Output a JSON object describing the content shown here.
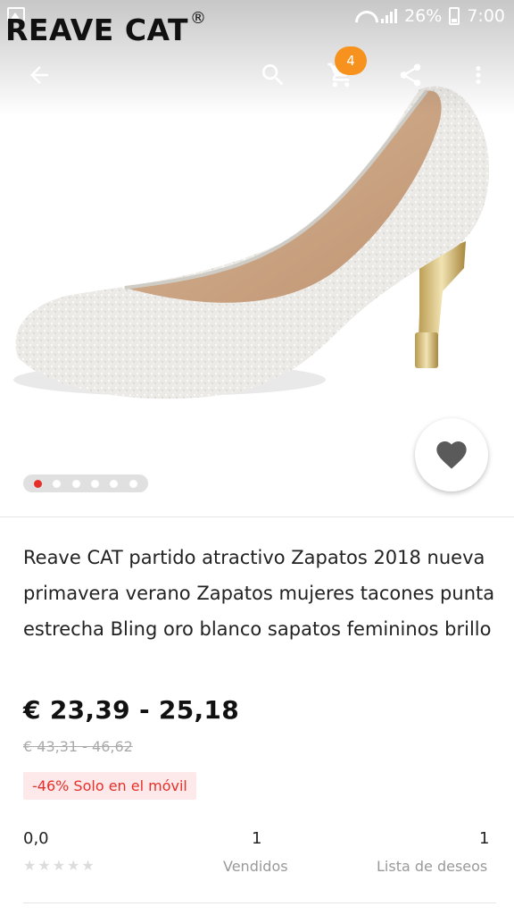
{
  "status_bar": {
    "battery": "26%",
    "time": "7:00"
  },
  "watermark": {
    "text": "REAVE CAT",
    "mark": "®"
  },
  "toolbar": {
    "back_icon": "arrow-back-icon",
    "search_icon": "search-icon",
    "cart_icon": "cart-icon",
    "cart_badge": "4",
    "share_icon": "share-icon",
    "more_icon": "more-vert-icon"
  },
  "gallery": {
    "image_count": 6,
    "active_index": 0
  },
  "favorite": {
    "icon": "heart-icon"
  },
  "product": {
    "title": "Reave CAT partido atractivo Zapatos 2018 nueva primavera verano Zapatos mujeres tacones punta estrecha Bling oro blanco sapatos femininos brillo",
    "price": "€ 23,39 - 25,18",
    "original_price": "€ 43,31 - 46,62",
    "discount": "-46% Solo en el móvil"
  },
  "stats": {
    "rating_value": "0,0",
    "stars_filled": 0,
    "stars_total": 5,
    "sold_value": "1",
    "sold_label": "Vendidos",
    "wishlist_value": "1",
    "wishlist_label": "Lista de deseos"
  },
  "colors": {
    "accent_red": "#e5302a",
    "badge_orange": "#f7921e",
    "discount_bg": "#fde9ea"
  }
}
